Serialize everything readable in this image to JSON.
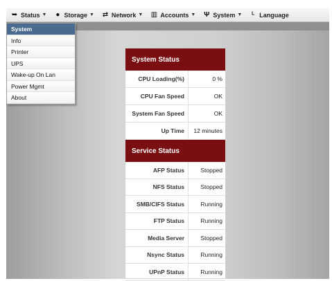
{
  "menubar": {
    "items": [
      {
        "label": "Status",
        "icon": "status-icon",
        "glyph": "➥"
      },
      {
        "label": "Storage",
        "icon": "storage-icon",
        "glyph": "●"
      },
      {
        "label": "Network",
        "icon": "network-icon",
        "glyph": "⇄"
      },
      {
        "label": "Accounts",
        "icon": "accounts-icon",
        "glyph": "▥"
      },
      {
        "label": "System",
        "icon": "system-icon",
        "glyph": "Ψ"
      },
      {
        "label": "Language",
        "icon": "language-icon",
        "glyph": "ᴸ"
      }
    ]
  },
  "dropdown": {
    "items": [
      "System",
      "Info",
      "Printer",
      "UPS",
      "Wake-up On Lan",
      "Power Mgmt",
      "About"
    ],
    "active": "System"
  },
  "system_status": {
    "title": "System Status",
    "rows": [
      {
        "label": "CPU Loading(%)",
        "value": "0 %"
      },
      {
        "label": "CPU Fan Speed",
        "value": "OK"
      },
      {
        "label": "System Fan Speed",
        "value": "OK"
      },
      {
        "label": "Up Time",
        "value": "12 minutes"
      }
    ]
  },
  "service_status": {
    "title": "Service Status",
    "rows": [
      {
        "label": "AFP Status",
        "value": "Stopped"
      },
      {
        "label": "NFS Status",
        "value": "Stopped"
      },
      {
        "label": "SMB/CIFS Status",
        "value": "Running"
      },
      {
        "label": "FTP Status",
        "value": "Running"
      },
      {
        "label": "Media Server",
        "value": "Stopped"
      },
      {
        "label": "Nsync Status",
        "value": "Running"
      },
      {
        "label": "UPnP Status",
        "value": "Running"
      }
    ]
  },
  "colors": {
    "header_bg": "#7a0f12",
    "active_menu_bg": "#4a6a8f"
  }
}
